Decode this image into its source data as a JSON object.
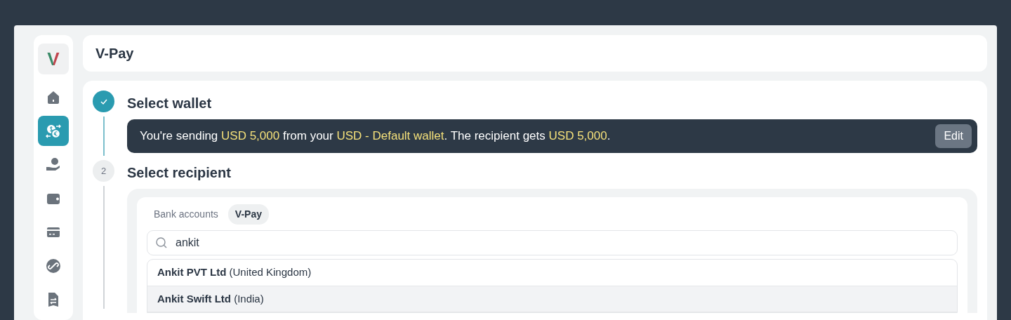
{
  "app": {
    "logo": "V",
    "title": "V-Pay"
  },
  "sidebar": {
    "items": [
      {
        "selected": false
      },
      {
        "selected": true
      },
      {
        "selected": false
      },
      {
        "selected": false
      },
      {
        "selected": false
      },
      {
        "selected": false
      },
      {
        "selected": false
      }
    ]
  },
  "steps": [
    {
      "title": "Select wallet",
      "done": true,
      "summary": [
        {
          "text": "You're sending ",
          "highlight": false
        },
        {
          "text": "USD 5,000",
          "highlight": true
        },
        {
          "text": " from your ",
          "highlight": false
        },
        {
          "text": "USD - Default wallet",
          "highlight": true
        },
        {
          "text": ". The recipient gets ",
          "highlight": false
        },
        {
          "text": "USD 5,000",
          "highlight": true
        },
        {
          "text": ".",
          "highlight": false
        }
      ],
      "edit_button": "Edit"
    },
    {
      "title": "Select recipient",
      "done": false,
      "number": "2",
      "tabs": [
        {
          "label": "Bank accounts",
          "selected": false
        },
        {
          "label": "V-Pay",
          "selected": true
        }
      ],
      "search": {
        "value": "ankit"
      },
      "results": [
        {
          "name": "Ankit PVT Ltd",
          "country": "(United Kingdom)",
          "selected": false
        },
        {
          "name": "Ankit Swift Ltd",
          "country": "(India)",
          "selected": true
        }
      ]
    }
  ]
}
